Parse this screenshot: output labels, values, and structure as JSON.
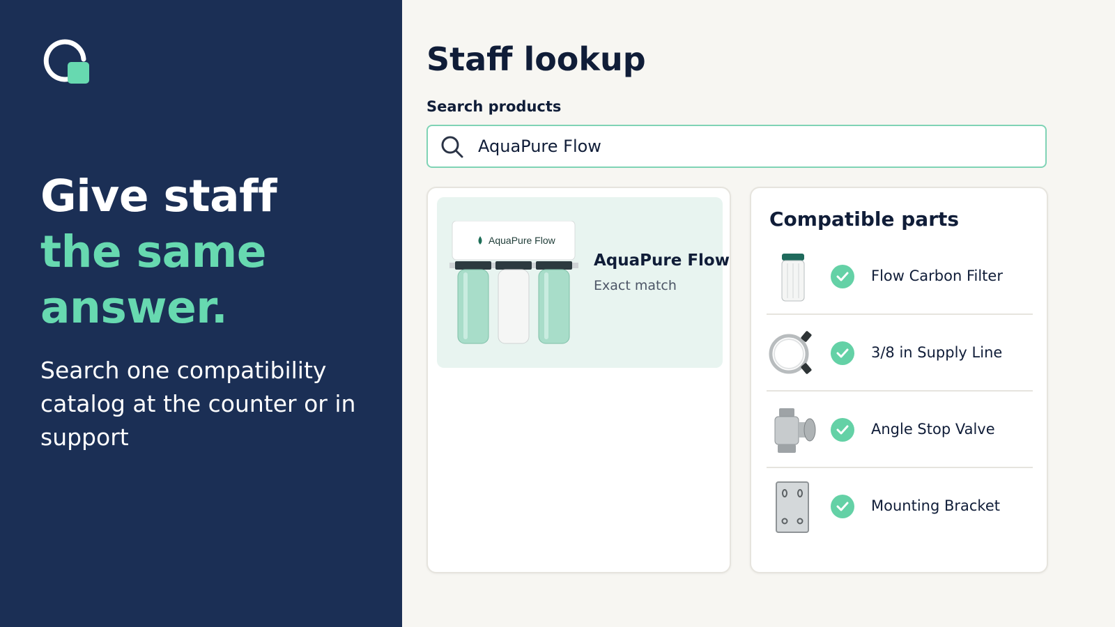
{
  "brand": {
    "logo_icon": "search-bag-logo-icon",
    "accent": "#67d9b0",
    "panel_color": "#1b2f55"
  },
  "hero": {
    "line1": "Give staff",
    "line2": "the same",
    "line3": "answer.",
    "subtitle": "Search one compatibility catalog at the counter or in support"
  },
  "page": {
    "title": "Staff lookup"
  },
  "search": {
    "label": "Search products",
    "value": "AquaPure Flow",
    "icon": "search-icon"
  },
  "result": {
    "product_label": "AquaPure Flow",
    "name": "AquaPure Flow",
    "match_type": "Exact match",
    "image_icon": "water-filter-system-icon"
  },
  "parts": {
    "title": "Compatible parts",
    "items": [
      {
        "label": "Flow Carbon Filter",
        "icon": "filter-cartridge-icon",
        "compatible": true
      },
      {
        "label": "3/8 in Supply Line",
        "icon": "supply-hose-icon",
        "compatible": true
      },
      {
        "label": "Angle Stop Valve",
        "icon": "valve-icon",
        "compatible": true
      },
      {
        "label": "Mounting Bracket",
        "icon": "bracket-icon",
        "compatible": true
      }
    ]
  }
}
